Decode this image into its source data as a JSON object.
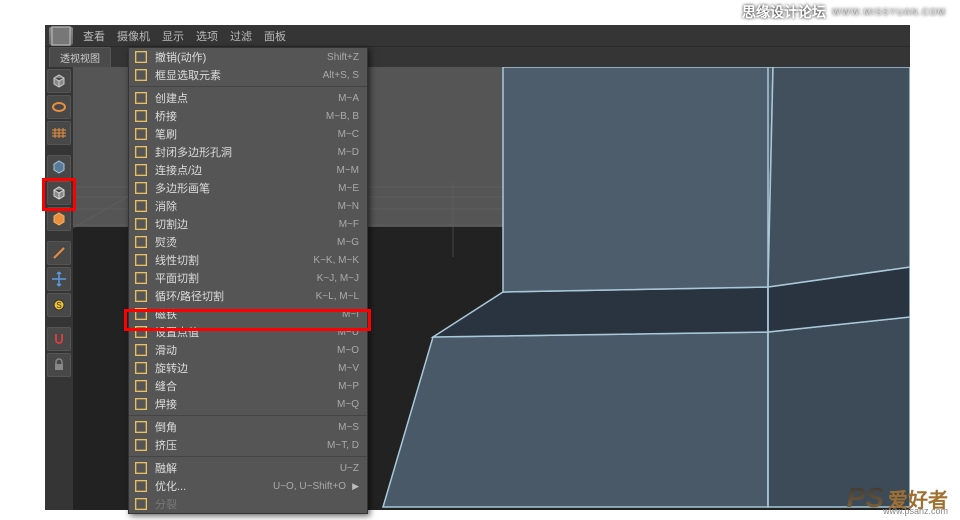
{
  "menubar": {
    "items": [
      "查看",
      "摄像机",
      "显示",
      "选项",
      "过滤",
      "面板"
    ]
  },
  "view_tab": {
    "label": "透视视图"
  },
  "palette": {
    "icons": [
      {
        "name": "cube-primitive-icon"
      },
      {
        "name": "torus-icon"
      },
      {
        "name": "floor-grid-icon"
      },
      {
        "name": "model-mode-icon"
      },
      {
        "name": "cube-select-icon"
      },
      {
        "name": "cube-orange-icon"
      },
      {
        "name": "edge-icon"
      },
      {
        "name": "move-tool-icon"
      },
      {
        "name": "scale-tool-icon"
      },
      {
        "name": "magnet-icon"
      },
      {
        "name": "lock-icon"
      }
    ],
    "highlighted_index": 4
  },
  "context_menu": {
    "items": [
      {
        "icon": "undo-icon",
        "label": "撤销(动作)",
        "shortcut": "Shift+Z"
      },
      {
        "icon": "frame-sel-icon",
        "label": "框显选取元素",
        "shortcut": "Alt+S, S"
      },
      {
        "sep": true
      },
      {
        "icon": "create-point-icon",
        "label": "创建点",
        "shortcut": "M~A"
      },
      {
        "icon": "bridge-icon",
        "label": "桥接",
        "shortcut": "M~B, B"
      },
      {
        "icon": "brush-icon",
        "label": "笔刷",
        "shortcut": "M~C"
      },
      {
        "icon": "close-hole-icon",
        "label": "封闭多边形孔洞",
        "shortcut": "M~D"
      },
      {
        "icon": "connect-icon",
        "label": "连接点/边",
        "shortcut": "M~M"
      },
      {
        "icon": "polypen-icon",
        "label": "多边形画笔",
        "shortcut": "M~E"
      },
      {
        "icon": "dissolve-icon",
        "label": "消除",
        "shortcut": "M~N"
      },
      {
        "icon": "edge-cut-icon",
        "label": "切割边",
        "shortcut": "M~F"
      },
      {
        "icon": "iron-icon",
        "label": "熨烫",
        "shortcut": "M~G"
      },
      {
        "icon": "knife-icon",
        "label": "线性切割",
        "shortcut": "K~K, M~K"
      },
      {
        "icon": "plane-cut-icon",
        "label": "平面切割",
        "shortcut": "K~J, M~J"
      },
      {
        "icon": "loop-cut-icon",
        "label": "循环/路径切割",
        "shortcut": "K~L, M~L",
        "highlighted": true
      },
      {
        "icon": "magnet2-icon",
        "label": "磁铁",
        "shortcut": "M~I"
      },
      {
        "icon": "set-val-icon",
        "label": "设置点值",
        "shortcut": "M~U"
      },
      {
        "icon": "slide-icon",
        "label": "滑动",
        "shortcut": "M~O"
      },
      {
        "icon": "spin-edge-icon",
        "label": "旋转边",
        "shortcut": "M~V"
      },
      {
        "icon": "stitch-icon",
        "label": "缝合",
        "shortcut": "M~P"
      },
      {
        "icon": "weld-icon",
        "label": "焊接",
        "shortcut": "M~Q"
      },
      {
        "sep": true
      },
      {
        "icon": "bevel-icon",
        "label": "倒角",
        "shortcut": "M~S"
      },
      {
        "icon": "extrude-icon",
        "label": "挤压",
        "shortcut": "M~T, D"
      },
      {
        "sep": true
      },
      {
        "icon": "dissolve2-icon",
        "label": "融解",
        "shortcut": "U~Z"
      },
      {
        "icon": "optimize-icon",
        "label": "优化...",
        "shortcut": "U~O, U~Shift+O",
        "arrow": true
      },
      {
        "icon": "split-icon",
        "label": "分裂",
        "shortcut": "",
        "disabled": true
      }
    ]
  },
  "watermark": {
    "top_text": "思缘设计论坛",
    "top_url": "WWW.MISSYUAN.COM",
    "bottom_ps": "PS",
    "bottom_cn": "爱好者",
    "bottom_url": "www.psahz.com"
  }
}
